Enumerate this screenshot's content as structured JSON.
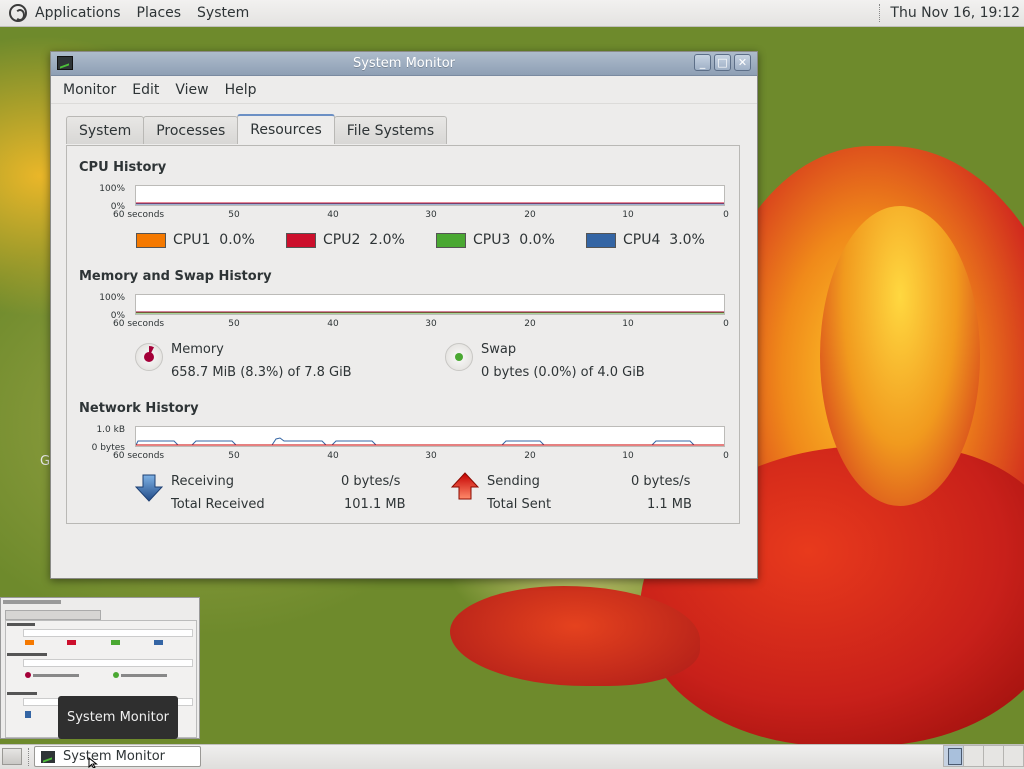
{
  "top_panel": {
    "menus": [
      "Applications",
      "Places",
      "System"
    ],
    "clock": "Thu Nov 16, 19:12"
  },
  "desktop": {
    "partial_label": "G"
  },
  "window": {
    "title": "System Monitor",
    "controls": {
      "minimize": "_",
      "maximize": "□",
      "close": "✕"
    },
    "menubar": [
      "Monitor",
      "Edit",
      "View",
      "Help"
    ],
    "tabs": [
      "System",
      "Processes",
      "Resources",
      "File Systems"
    ],
    "active_tab": "Resources",
    "time_axis": [
      "60 seconds",
      "50",
      "40",
      "30",
      "20",
      "10",
      "0"
    ],
    "cpu": {
      "title": "CPU History",
      "y_top": "100%",
      "y_bottom": "0%",
      "cores": [
        {
          "label": "CPU1",
          "value": "0.0%",
          "color": "#f57900"
        },
        {
          "label": "CPU2",
          "value": "2.0%",
          "color": "#cc0f2c"
        },
        {
          "label": "CPU3",
          "value": "0.0%",
          "color": "#4aa832"
        },
        {
          "label": "CPU4",
          "value": "3.0%",
          "color": "#3465a4"
        }
      ]
    },
    "memory": {
      "title": "Memory and Swap History",
      "y_top": "100%",
      "y_bottom": "0%",
      "memory_label": "Memory",
      "memory_value": "658.7 MiB (8.3%) of 7.8 GiB",
      "memory_fraction": 0.083,
      "memory_color": "#a40038",
      "swap_label": "Swap",
      "swap_value": "0 bytes (0.0%) of 4.0 GiB",
      "swap_fraction": 0.0,
      "swap_color": "#4aa832"
    },
    "network": {
      "title": "Network History",
      "y_top": "1.0 kB",
      "y_bottom": "0 bytes",
      "receiving_label": "Receiving",
      "receiving_rate": "0 bytes/s",
      "total_received_label": "Total Received",
      "total_received": "101.1 MB",
      "sending_label": "Sending",
      "sending_rate": "0 bytes/s",
      "total_sent_label": "Total Sent",
      "total_sent": "1.1 MB",
      "receiving_color": "#3465a4",
      "sending_color": "#cc0000"
    }
  },
  "taskbar": {
    "task_label": "System Monitor",
    "tooltip": "System Monitor",
    "workspaces": 4,
    "active_workspace": 1
  }
}
